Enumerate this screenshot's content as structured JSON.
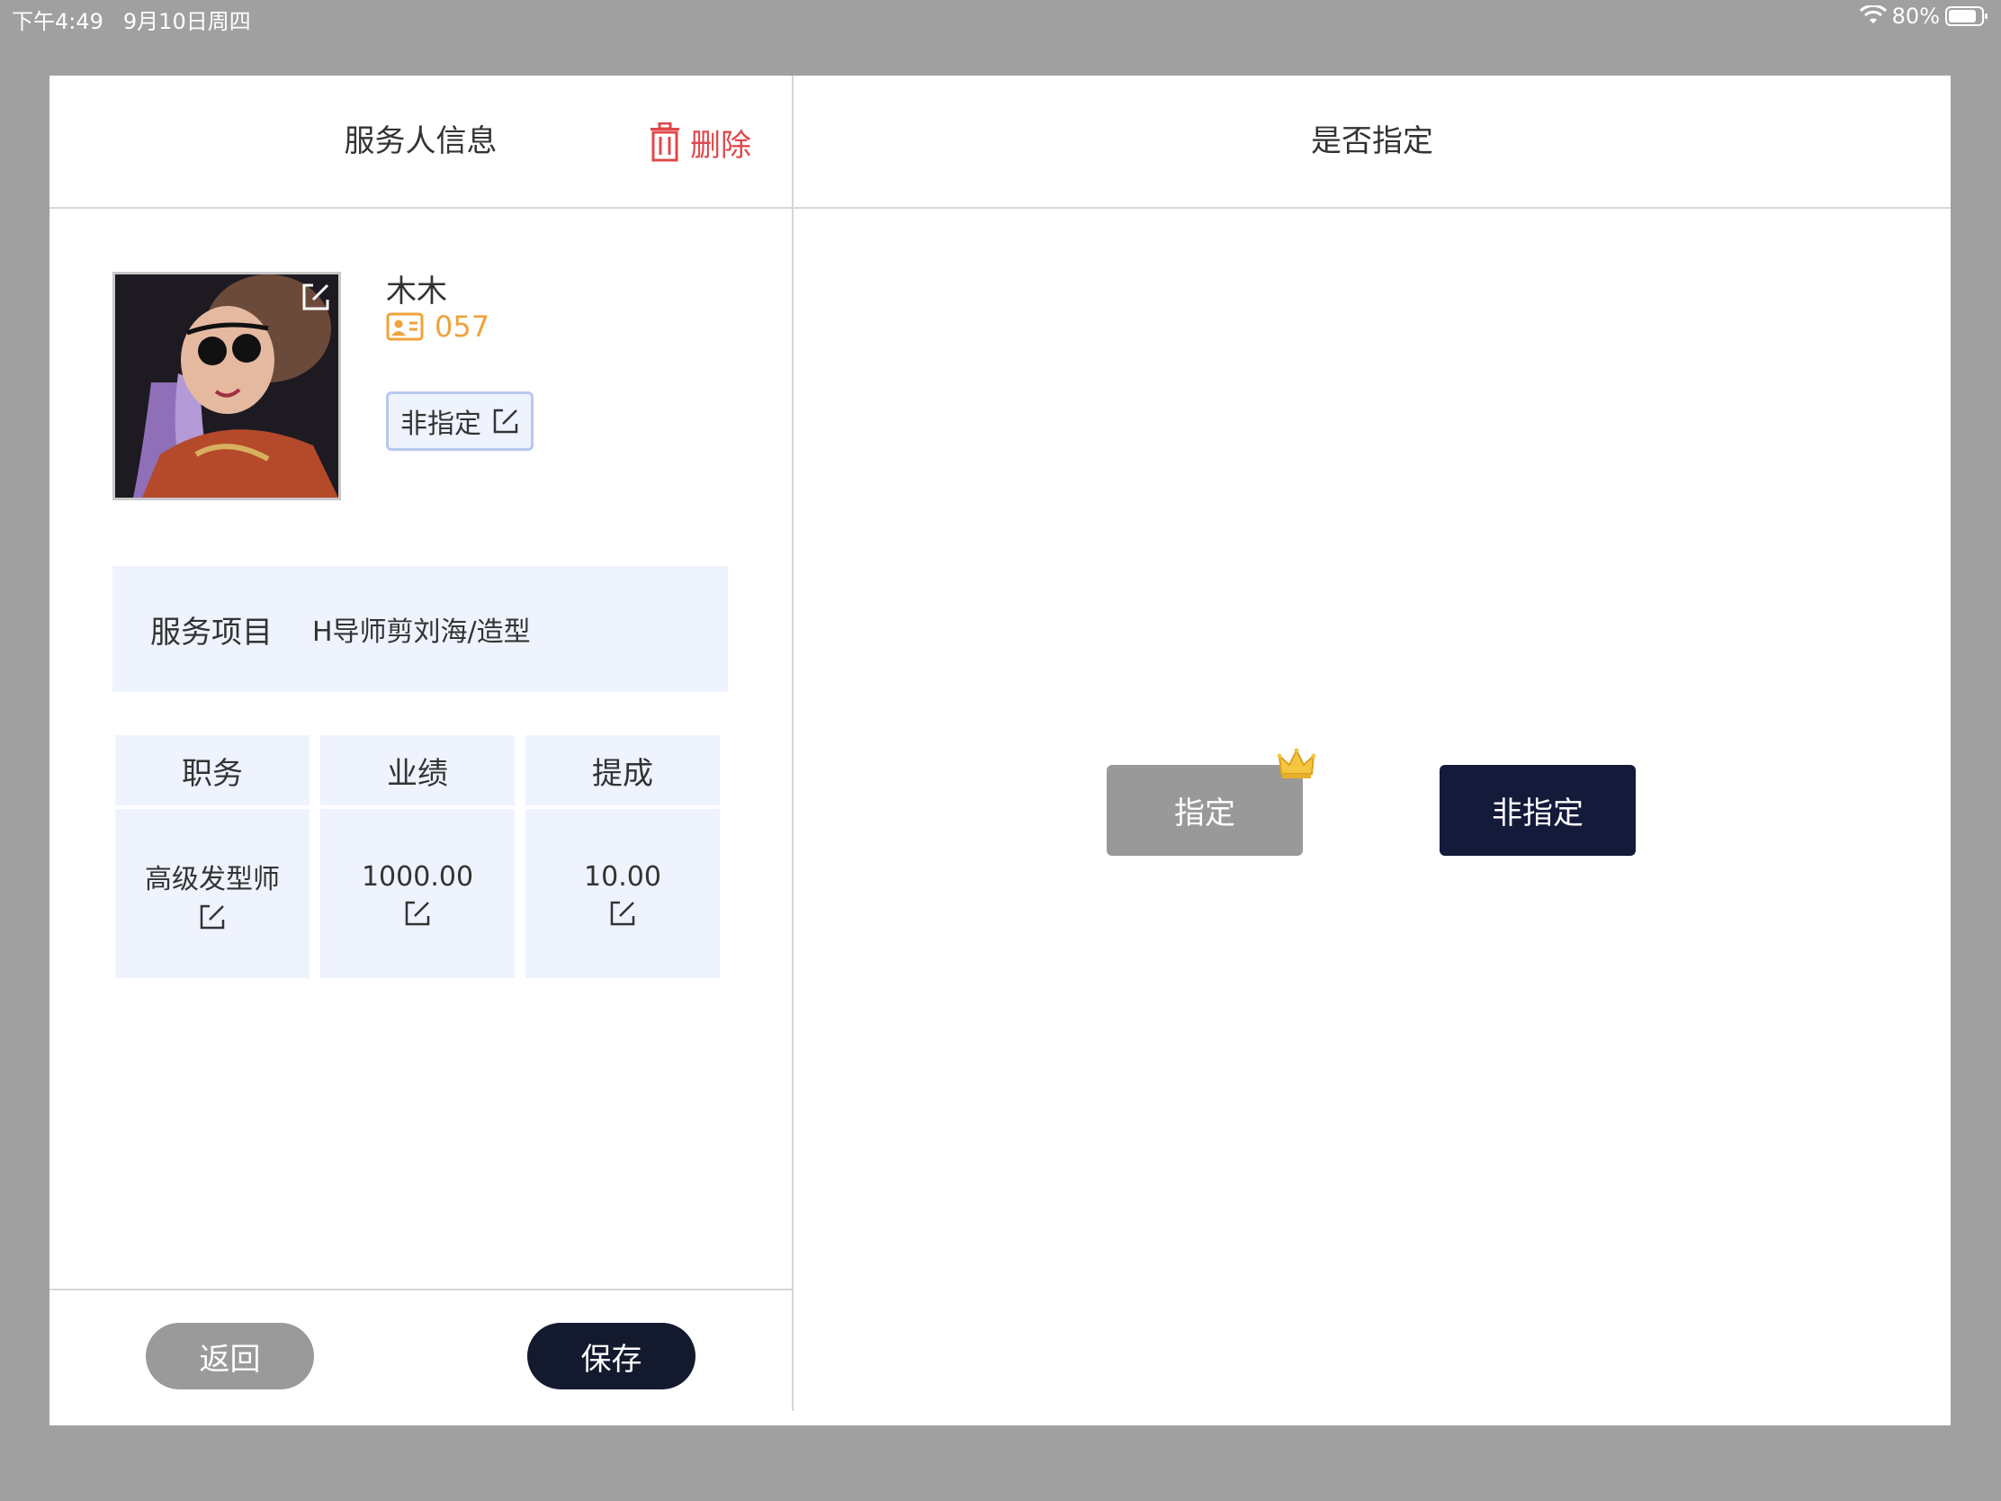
{
  "status_bar": {
    "time": "下午4:49",
    "date": "9月10日周四",
    "battery": "80%"
  },
  "left": {
    "title": "服务人信息",
    "delete_label": "删除",
    "staff_name": "木木",
    "staff_id": "057",
    "designation_tag": "非指定",
    "service_label": "服务项目",
    "service_value": "H导师剪刘海/造型",
    "columns": [
      {
        "header": "职务",
        "value": "高级发型师"
      },
      {
        "header": "业绩",
        "value": "1000.00"
      },
      {
        "header": "提成",
        "value": "10.00"
      }
    ],
    "back_label": "返回",
    "save_label": "保存"
  },
  "right": {
    "title": "是否指定",
    "designated_label": "指定",
    "nondesignated_label": "非指定"
  },
  "colors": {
    "accent_dark": "#141a2e",
    "delete_red": "#e0474c",
    "id_orange": "#f0a23c",
    "panel_blue": "#eef3fe"
  }
}
